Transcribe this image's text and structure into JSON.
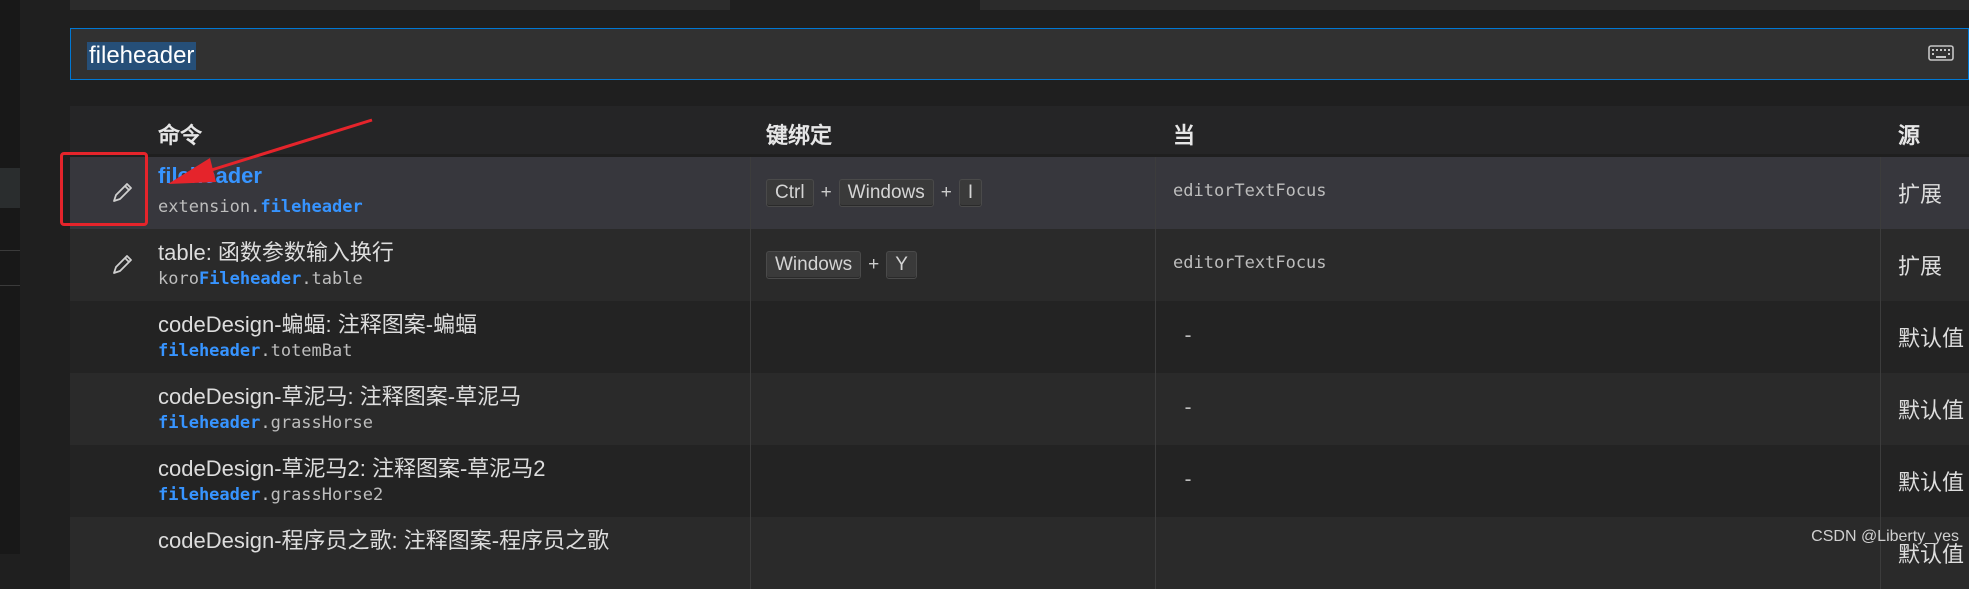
{
  "search": {
    "value": "fileheader",
    "keyboard_icon": "keyboard-icon"
  },
  "table": {
    "headers": {
      "command": "命令",
      "keybinding": "键绑定",
      "when": "当",
      "source": "源"
    },
    "rows": [
      {
        "title": "fileheader",
        "id_prefix": "extension.",
        "id_match": "fileheader",
        "id_suffix": "",
        "keys": [
          "Ctrl",
          "Windows",
          "I"
        ],
        "when": "editorTextFocus",
        "source": "扩展",
        "has_edit": true
      },
      {
        "title": "table: 函数参数输入换行",
        "id_prefix": "koro",
        "id_match": "Fileheader",
        "id_suffix": ".table",
        "keys": [
          "Windows",
          "Y"
        ],
        "when": "editorTextFocus",
        "source": "扩展",
        "has_edit": true
      },
      {
        "title": "codeDesign-蝙蝠: 注释图案-蝙蝠",
        "id_prefix": "",
        "id_match": "fileheader",
        "id_suffix": ".totemBat",
        "keys": [],
        "when": "-",
        "source": "默认值",
        "has_edit": false
      },
      {
        "title": "codeDesign-草泥马: 注释图案-草泥马",
        "id_prefix": "",
        "id_match": "fileheader",
        "id_suffix": ".grassHorse",
        "keys": [],
        "when": "-",
        "source": "默认值",
        "has_edit": false
      },
      {
        "title": "codeDesign-草泥马2: 注释图案-草泥马2",
        "id_prefix": "",
        "id_match": "fileheader",
        "id_suffix": ".grassHorse2",
        "keys": [],
        "when": "-",
        "source": "默认值",
        "has_edit": false
      },
      {
        "title": "codeDesign-程序员之歌: 注释图案-程序员之歌",
        "id_prefix": "",
        "id_match": "",
        "id_suffix": "",
        "keys": [],
        "when": "",
        "source": "默认值",
        "has_edit": false
      }
    ]
  },
  "watermark": "CSDN @Liberty_yes",
  "colors": {
    "accent": "#0078d4",
    "match": "#3794ff",
    "annotation": "#e5242b"
  }
}
